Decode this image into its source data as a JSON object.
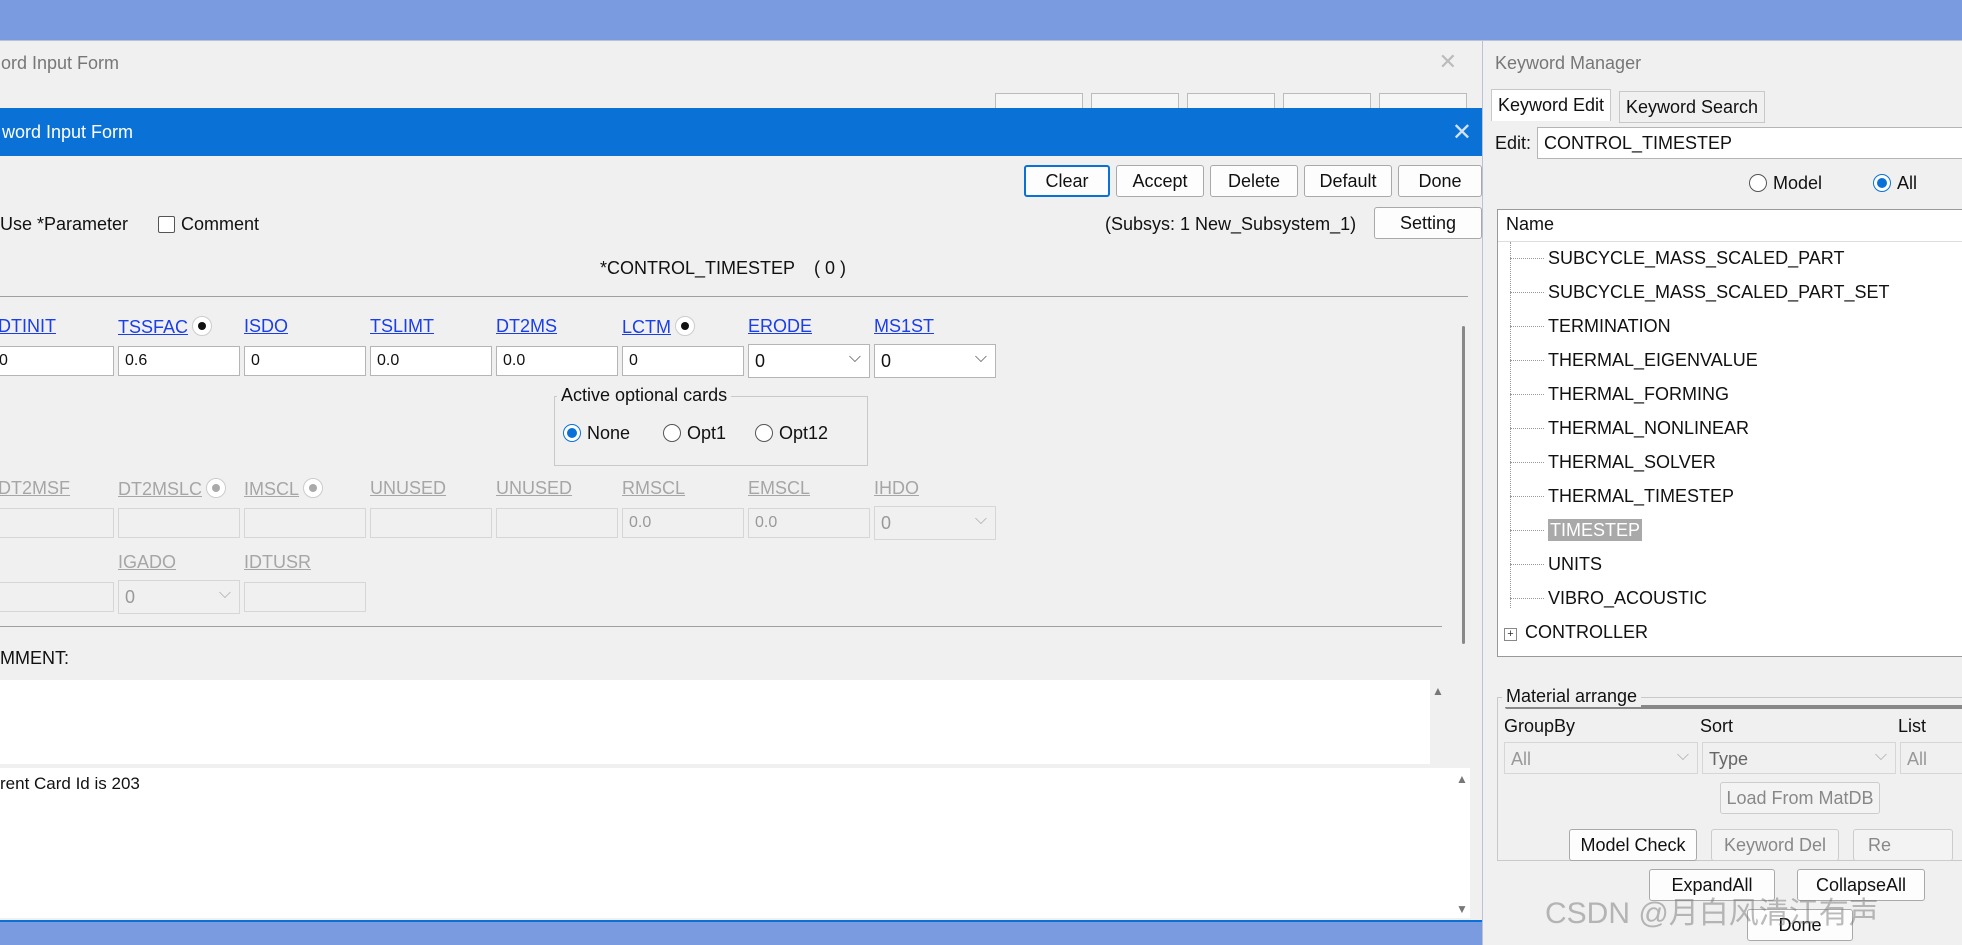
{
  "background_window": {
    "title": "ord Input Form"
  },
  "dialog": {
    "title": "word Input Form",
    "buttons": {
      "clear": "Clear",
      "accept": "Accept",
      "delete": "Delete",
      "default": "Default",
      "done": "Done"
    },
    "use_parameter_label": "Use *Parameter",
    "comment_checkbox_label": "Comment",
    "subsys_label": "(Subsys: 1 New_Subsystem_1)",
    "setting_button": "Setting",
    "keyword_title": "*CONTROL_TIMESTEP",
    "keyword_count": "( 0 )",
    "card1": {
      "headers": [
        "DTINIT",
        "TSSFAC",
        "ISDO",
        "TSLIMT",
        "DT2MS",
        "LCTM",
        "ERODE",
        "MS1ST"
      ],
      "values": [
        "0",
        "0.6",
        "0",
        "0.0",
        "0.0",
        "0",
        "0",
        "0"
      ]
    },
    "optional_cards": {
      "legend": "Active optional cards",
      "options": [
        "None",
        "Opt1",
        "Opt12"
      ],
      "selected": "None"
    },
    "card2": {
      "headers": [
        "DT2MSF",
        "DT2MSLC",
        "IMSCL",
        "UNUSED",
        "UNUSED",
        "RMSCL",
        "EMSCL",
        "IHDO"
      ],
      "values": [
        "",
        "",
        "",
        "",
        "",
        "0.0",
        "0.0",
        "0"
      ]
    },
    "card3": {
      "headers": [
        "",
        "IGADO",
        "IDTUSR"
      ],
      "igado_value": "0"
    },
    "comment_label": "MMENT:",
    "message": "rent Card Id is 203"
  },
  "keyword_manager": {
    "title": "Keyword Manager",
    "tabs": [
      "Keyword Edit",
      "Keyword Search"
    ],
    "edit_label": "Edit:",
    "edit_value": "CONTROL_TIMESTEP",
    "radios": [
      "Model",
      "All"
    ],
    "radio_selected": "All",
    "tree_header": "Name",
    "tree_items": [
      "SUBCYCLE_MASS_SCALED_PART",
      "SUBCYCLE_MASS_SCALED_PART_SET",
      "TERMINATION",
      "THERMAL_EIGENVALUE",
      "THERMAL_FORMING",
      "THERMAL_NONLINEAR",
      "THERMAL_SOLVER",
      "THERMAL_TIMESTEP",
      "TIMESTEP",
      "UNITS",
      "VIBRO_ACOUSTIC"
    ],
    "selected_item": "TIMESTEP",
    "tree_root": "CONTROLLER",
    "material": {
      "legend": "Material arrange",
      "groupby_label": "GroupBy",
      "sort_label": "Sort",
      "list_label": "List",
      "groupby_value": "All",
      "sort_value": "Type",
      "list_value": "All",
      "load_button": "Load From MatDB"
    },
    "buttons": {
      "model_check": "Model Check",
      "keyword_del": "Keyword Del",
      "re": "Re",
      "expand_all": "ExpandAll",
      "collapse_all": "CollapseAll",
      "done": "Done"
    }
  },
  "watermark": "CSDN @月白风清江有声",
  "colors": {
    "accent": "#0a72d6",
    "link": "#1a3ee8",
    "desktop": "#7b9be0"
  }
}
